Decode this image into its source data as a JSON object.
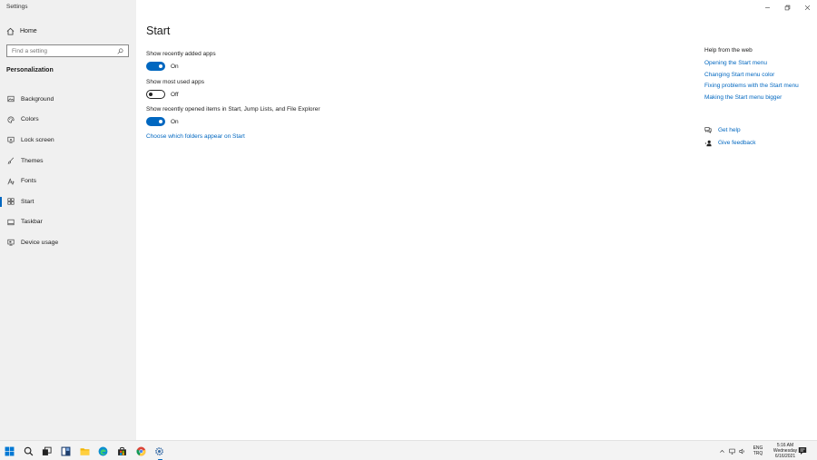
{
  "window": {
    "title": "Settings"
  },
  "sidebar": {
    "home_label": "Home",
    "search_placeholder": "Find a setting",
    "section": "Personalization",
    "items": [
      {
        "label": "Background",
        "icon": "picture-icon"
      },
      {
        "label": "Colors",
        "icon": "palette-icon"
      },
      {
        "label": "Lock screen",
        "icon": "lock-screen-icon"
      },
      {
        "label": "Themes",
        "icon": "brush-icon"
      },
      {
        "label": "Fonts",
        "icon": "font-icon"
      },
      {
        "label": "Start",
        "icon": "start-layout-icon",
        "active": true
      },
      {
        "label": "Taskbar",
        "icon": "taskbar-icon"
      },
      {
        "label": "Device usage",
        "icon": "device-usage-icon"
      }
    ]
  },
  "main": {
    "title": "Start",
    "settings": [
      {
        "label": "Show recently added apps",
        "state": "On",
        "on": true
      },
      {
        "label": "Show most used apps",
        "state": "Off",
        "on": false
      },
      {
        "label": "Show recently opened items in Start, Jump Lists, and File Explorer",
        "state": "On",
        "on": true
      }
    ],
    "folders_link": "Choose which folders appear on Start"
  },
  "help": {
    "title": "Help from the web",
    "links": [
      "Opening the Start menu",
      "Changing Start menu color",
      "Fixing problems with the Start menu",
      "Making the Start menu bigger"
    ],
    "get_help": "Get help",
    "give_feedback": "Give feedback"
  },
  "taskbar": {
    "apps": [
      "windows-start-icon",
      "search-icon",
      "task-view-icon",
      "widgets-icon",
      "file-explorer-icon",
      "edge-icon",
      "store-icon",
      "chrome-icon",
      "settings-gear-icon"
    ],
    "lang_1": "ENG",
    "lang_2": "TRQ",
    "time": "5:16 AM",
    "day": "Wednesday",
    "date": "6/16/2021"
  },
  "colors": {
    "accent": "#0067c0",
    "sidebar_bg": "#f0f0f0",
    "taskbar_bg": "#f3f3f3"
  }
}
